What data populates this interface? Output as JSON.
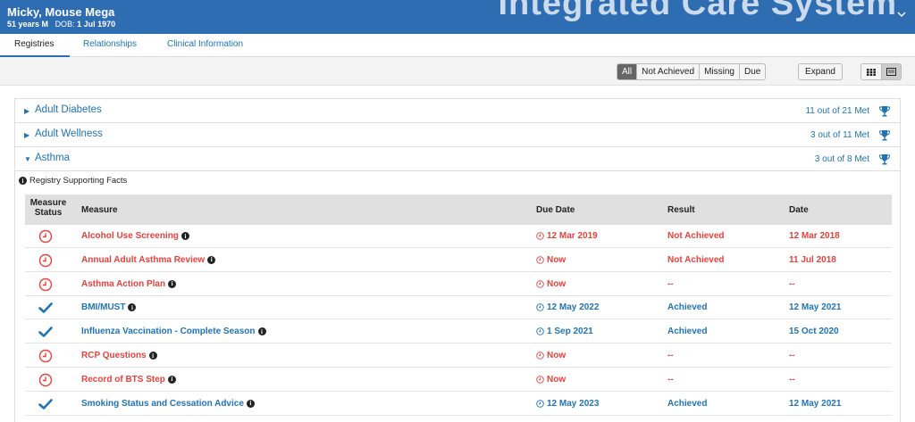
{
  "header": {
    "patient_name": "Micky, Mouse Mega",
    "age_sex": "51 years  M",
    "dob_label": "DOB:",
    "dob_value": "1 Jul 1970",
    "app_title": "Integrated Care System",
    "expand_icon": "chevron-down-icon"
  },
  "tabs": [
    {
      "label": "Registries",
      "active": true
    },
    {
      "label": "Relationships",
      "active": false
    },
    {
      "label": "Clinical Information",
      "active": false
    }
  ],
  "toolbar": {
    "filters": [
      {
        "label": "All",
        "active": true
      },
      {
        "label": "Not Achieved",
        "active": false
      },
      {
        "label": "Missing",
        "active": false
      },
      {
        "label": "Due",
        "active": false
      }
    ],
    "expand_label": "Expand",
    "views": [
      {
        "icon": "grid-view-icon",
        "active": false
      },
      {
        "icon": "list-view-icon",
        "active": true
      }
    ]
  },
  "registries": [
    {
      "name": "Adult Diabetes",
      "met": "11 out of 21 Met",
      "expanded": false
    },
    {
      "name": "Adult Wellness",
      "met": "3 out of 11 Met",
      "expanded": false
    },
    {
      "name": "Asthma",
      "met": "3 out of 8 Met",
      "expanded": true
    }
  ],
  "supporting_facts": "Registry Supporting Facts",
  "table": {
    "headers": {
      "status_line1": "Measure",
      "status_line2": "Status",
      "measure": "Measure",
      "due_date": "Due Date",
      "result": "Result",
      "date": "Date"
    },
    "rows": [
      {
        "status": "pending",
        "measure": "Alcohol Use Screening",
        "due": "12 Mar 2019",
        "result": "Not Achieved",
        "date": "12 Mar 2018"
      },
      {
        "status": "pending",
        "measure": "Annual Adult Asthma Review",
        "due": "Now",
        "result": "Not Achieved",
        "date": "11 Jul 2018"
      },
      {
        "status": "pending",
        "measure": "Asthma Action Plan",
        "due": "Now",
        "result": "--",
        "date": "--"
      },
      {
        "status": "met",
        "measure": "BMI/MUST",
        "due": "12 May 2022",
        "result": "Achieved",
        "date": "12 May 2021"
      },
      {
        "status": "met",
        "measure": "Influenza Vaccination - Complete Season",
        "due": "1 Sep 2021",
        "result": "Achieved",
        "date": "15 Oct 2020"
      },
      {
        "status": "pending",
        "measure": "RCP Questions",
        "due": "Now",
        "result": "--",
        "date": "--"
      },
      {
        "status": "pending",
        "measure": "Record of BTS Step",
        "due": "Now",
        "result": "--",
        "date": "--"
      },
      {
        "status": "met",
        "measure": "Smoking Status and Cessation Advice",
        "due": "12 May 2023",
        "result": "Achieved",
        "date": "12 May 2021"
      }
    ]
  },
  "colors": {
    "header_bg": "#2f6db2",
    "link_blue": "#1f73b7",
    "alert_red": "#e8413c"
  }
}
